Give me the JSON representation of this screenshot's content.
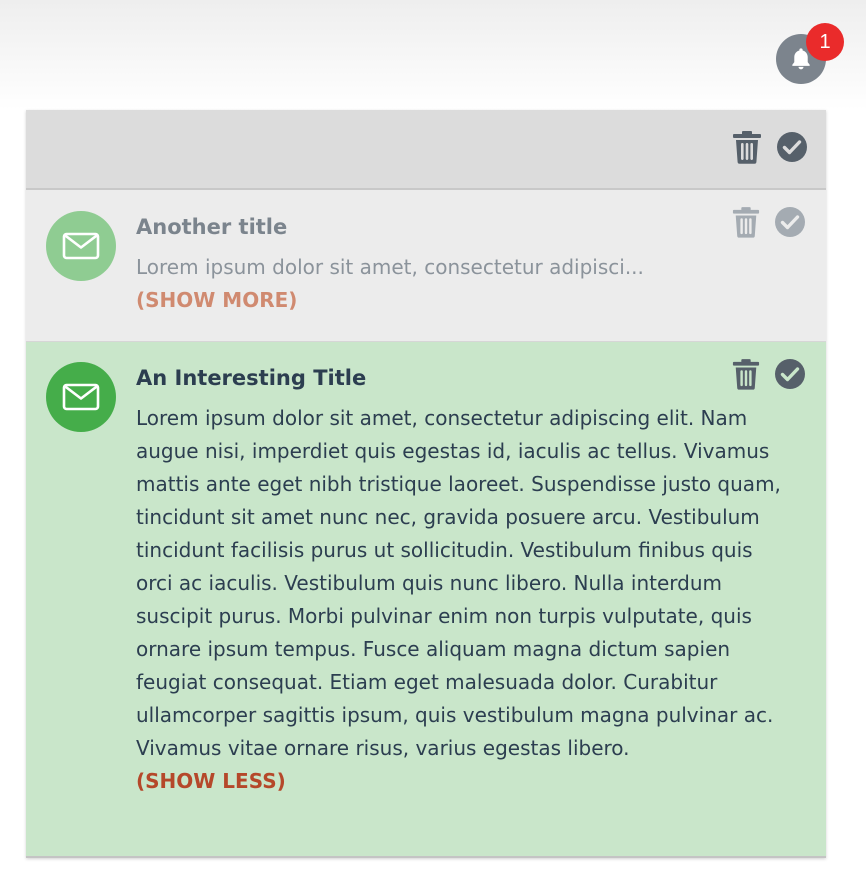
{
  "notifications_bell": {
    "icon": "bell-icon",
    "badge_count": "1",
    "badge_color": "#ea2b2b"
  },
  "header": {
    "actions": [
      "trash-icon",
      "check-circle-icon"
    ]
  },
  "items": [
    {
      "state": "read",
      "icon": "envelope-icon",
      "title": "Another title",
      "text": "Lorem ipsum dolor sit amet, consectetur adipisci...",
      "toggle_label": "(SHOW MORE)"
    },
    {
      "state": "unread",
      "icon": "envelope-icon",
      "title": "An Interesting Title",
      "text": "Lorem ipsum dolor sit amet, consectetur adipiscing elit. Nam augue nisi, imperdiet quis egestas id, iaculis ac tellus. Vivamus mattis ante eget nibh tristique laoreet. Suspendisse justo quam, tincidunt sit amet nunc nec, gravida posuere arcu. Vestibulum tincidunt facilisis purus ut sollicitudin. Vestibulum finibus quis orci ac iaculis. Vestibulum quis nunc libero. Nulla interdum suscipit purus. Morbi pulvinar enim non turpis vulputate, quis ornare ipsum tempus. Fusce aliquam magna dictum sapien feugiat consequat. Etiam eget malesuada dolor. Curabitur ullamcorper sagittis ipsum, quis vestibulum magna pulvinar ac. Vivamus vitae ornare risus, varius egestas libero.",
      "toggle_label": "(SHOW LESS)"
    }
  ],
  "colors": {
    "read_background": "#ececec",
    "unread_background": "#c9e6ca",
    "unread_avatar": "#45ad4a",
    "read_avatar": "#8fcc92",
    "toggle_link": "#b5482a"
  }
}
